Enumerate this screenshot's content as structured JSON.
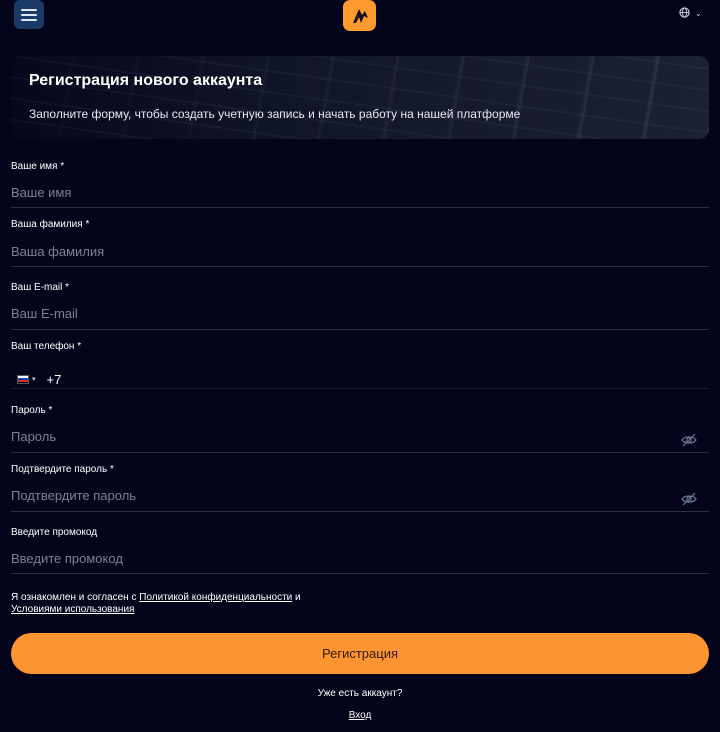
{
  "header": {
    "menu_icon": "hamburger-icon",
    "logo_icon": "brand-logo",
    "language_icon": "globe-icon",
    "language_chevron": "chevron-down-icon"
  },
  "banner": {
    "title": "Регистрация нового аккаунта",
    "subtitle": "Заполните форму, чтобы создать учетную запись и начать работу на нашей платформе"
  },
  "form": {
    "first_name": {
      "label": "Ваше имя *",
      "placeholder": "Ваше имя",
      "value": ""
    },
    "last_name": {
      "label": "Ваша фамилия *",
      "placeholder": "Ваша фамилия",
      "value": ""
    },
    "email": {
      "label": "Ваш E-mail *",
      "placeholder": "Ваш E-mail",
      "value": ""
    },
    "phone": {
      "label": "Ваш телефон *",
      "country_flag": "russia-flag-icon",
      "prefix": "+7",
      "value": ""
    },
    "password": {
      "label": "Пароль *",
      "placeholder": "Пароль",
      "value": "",
      "toggle_icon": "eye-off-icon"
    },
    "password_confirm": {
      "label": "Подтвердите пароль *",
      "placeholder": "Подтвердите пароль",
      "value": "",
      "toggle_icon": "eye-off-icon"
    },
    "promo": {
      "label": "Введите промокод",
      "placeholder": "Введите промокод",
      "value": ""
    }
  },
  "terms": {
    "text_start": "Я ознакомлен и согласен с ",
    "privacy_link": "Политикой конфиденциальности",
    "text_and": " и ",
    "terms_link": "Условиями использования"
  },
  "submit_label": "Регистрация",
  "footer": {
    "have_account": "Уже есть аккаунт?",
    "login_link": "Вход"
  },
  "colors": {
    "background": "#04051a",
    "accent": "#ff9532",
    "menu_button": "#1b3a66",
    "input_line": "#283045"
  }
}
